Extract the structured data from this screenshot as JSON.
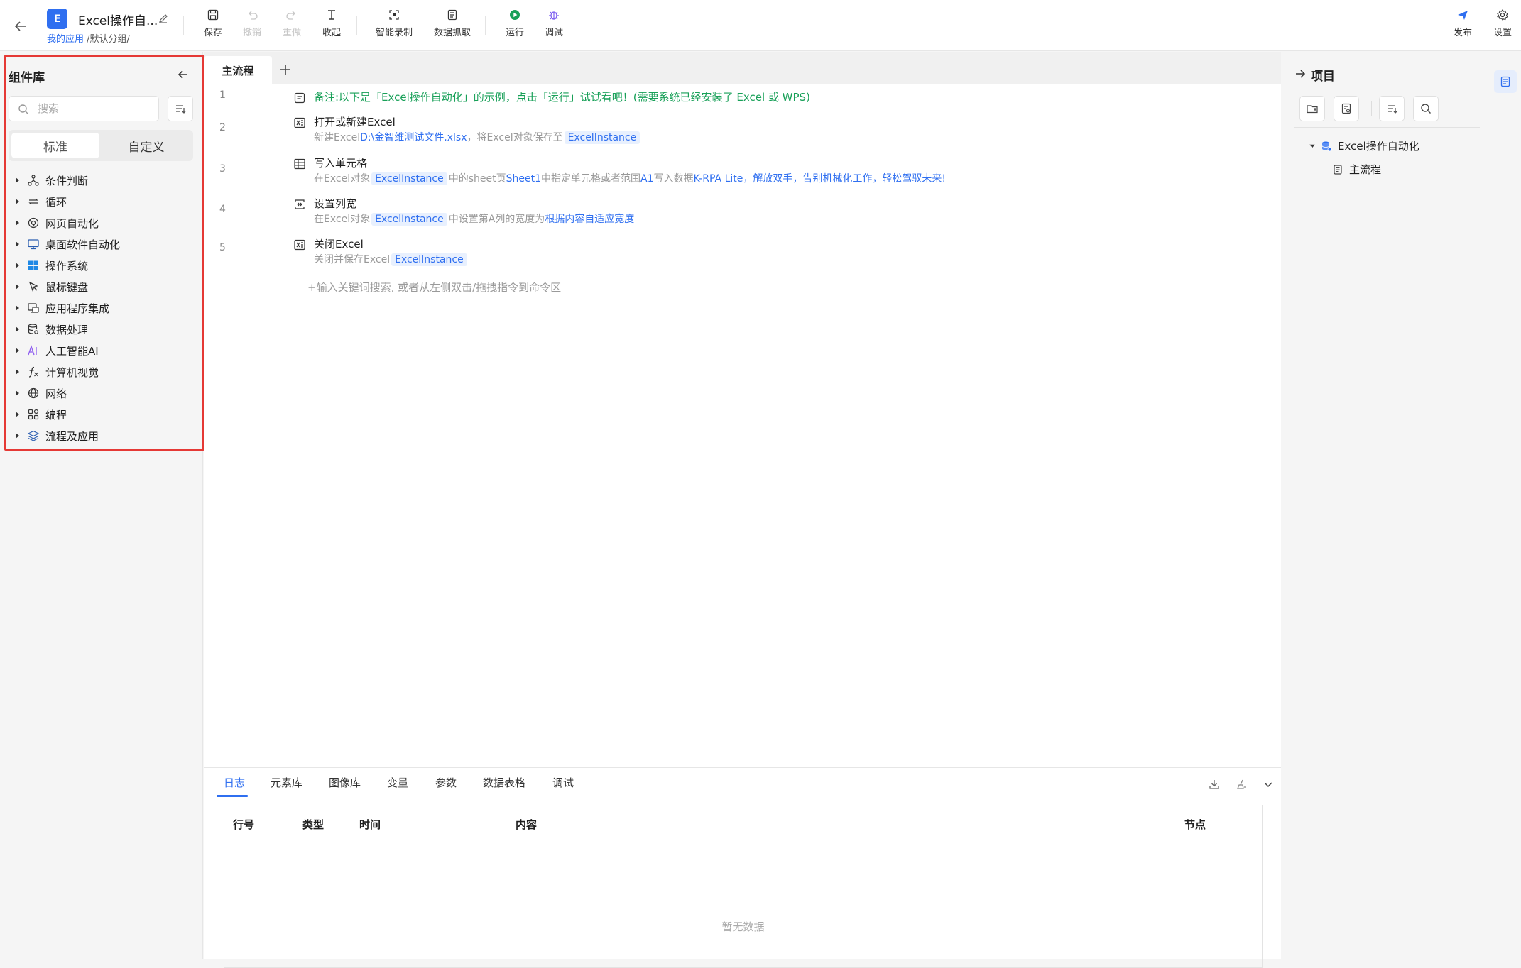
{
  "app": {
    "logo_letter": "E",
    "name": "Excel操作自...",
    "breadcrumb_link": "我的应用",
    "breadcrumb_rest": " /默认分组/"
  },
  "toolbar": {
    "save": "保存",
    "undo": "撤销",
    "redo": "重做",
    "collapse": "收起",
    "smart_record": "智能录制",
    "data_capture": "数据抓取",
    "run": "运行",
    "debug": "调试",
    "publish": "发布",
    "settings": "设置"
  },
  "library": {
    "title": "组件库",
    "search_placeholder": "搜索",
    "tabs": [
      "标准",
      "自定义"
    ],
    "categories": [
      {
        "label": "条件判断",
        "icon": "branch-icon"
      },
      {
        "label": "循环",
        "icon": "loop-icon"
      },
      {
        "label": "网页自动化",
        "icon": "browser-icon"
      },
      {
        "label": "桌面软件自动化",
        "icon": "monitor-icon"
      },
      {
        "label": "操作系统",
        "icon": "windows-icon"
      },
      {
        "label": "鼠标键盘",
        "icon": "cursor-icon"
      },
      {
        "label": "应用程序集成",
        "icon": "app-integration-icon"
      },
      {
        "label": "数据处理",
        "icon": "database-icon"
      },
      {
        "label": "人工智能AI",
        "icon": "ai-icon"
      },
      {
        "label": "计算机视觉",
        "icon": "function-icon"
      },
      {
        "label": "网络",
        "icon": "globe-icon"
      },
      {
        "label": "编程",
        "icon": "code-blocks-icon"
      },
      {
        "label": "流程及应用",
        "icon": "layers-icon"
      }
    ]
  },
  "editor": {
    "tab_label": "主流程",
    "line_numbers": [
      "1",
      "2",
      "3",
      "4",
      "5"
    ],
    "steps": [
      {
        "title": "备注:以下是「Excel操作自动化」的示例，点击「运行」试试看吧！(需要系统已经安装了 Excel 或 WPS)"
      },
      {
        "title": "打开或新建Excel",
        "d1": "新建Excel",
        "d2": "D:\\金智维测试文件.xlsx",
        "d3": "，将Excel对象保存至",
        "var": "ExcelInstance"
      },
      {
        "title": "写入单元格",
        "d1": "在Excel对象",
        "var": "ExcelInstance",
        "d2": "中的sheet页",
        "d3": "Sheet1",
        "d4": "中指定单元格或者范围",
        "d5": "A1",
        "d6": "写入数据",
        "d7": "K-RPA Lite，解放双手，告别机械化工作，轻松驾驭未来!"
      },
      {
        "title": "设置列宽",
        "d1": "在Excel对象",
        "var": "ExcelInstance",
        "d2": "中设置第A列的宽度为",
        "d3": "根据内容自适应宽度"
      },
      {
        "title": "关闭Excel",
        "d1": "关闭并保存Excel",
        "var": "ExcelInstance"
      }
    ],
    "hint": "+输入关键词搜索, 或者从左侧双击/拖拽指令到命令区"
  },
  "bottom": {
    "tabs": [
      "日志",
      "元素库",
      "图像库",
      "变量",
      "参数",
      "数据表格",
      "调试"
    ],
    "columns": [
      "行号",
      "类型",
      "时间",
      "内容",
      "节点"
    ],
    "empty_text": "暂无数据"
  },
  "project": {
    "title": "项目",
    "root": "Excel操作自动化",
    "child": "主流程"
  },
  "colors": {
    "accent": "#2f6ff0",
    "note_green": "#18a058",
    "highlight_red": "#e53935"
  }
}
